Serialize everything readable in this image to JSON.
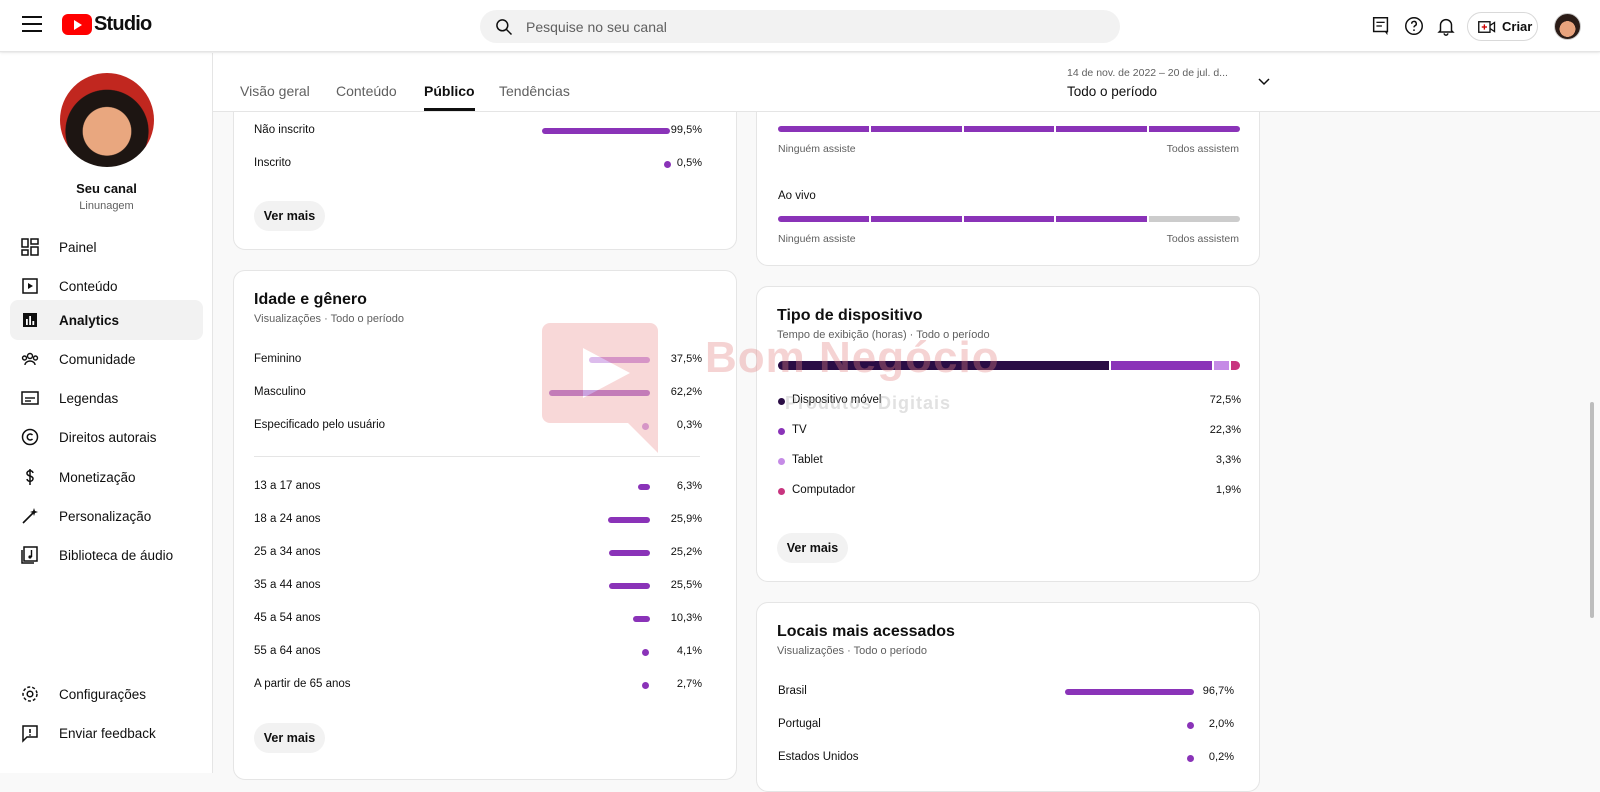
{
  "app": {
    "logo_text": "Studio",
    "search_placeholder": "Pesquise no seu canal",
    "create_label": "Criar"
  },
  "channel": {
    "name": "Seu canal",
    "handle": "Linunagem"
  },
  "sidebar": {
    "items": [
      {
        "label": "Painel",
        "icon": "dashboard-icon"
      },
      {
        "label": "Conteúdo",
        "icon": "content-icon"
      },
      {
        "label": "Analytics",
        "icon": "analytics-icon",
        "active": true
      },
      {
        "label": "Comunidade",
        "icon": "community-icon"
      },
      {
        "label": "Legendas",
        "icon": "subtitles-icon"
      },
      {
        "label": "Direitos autorais",
        "icon": "copyright-icon"
      },
      {
        "label": "Monetização",
        "icon": "monetization-icon"
      },
      {
        "label": "Personalização",
        "icon": "customization-icon"
      },
      {
        "label": "Biblioteca de áudio",
        "icon": "audio-library-icon"
      }
    ],
    "bottom": [
      {
        "label": "Configurações",
        "icon": "settings-icon"
      },
      {
        "label": "Enviar feedback",
        "icon": "feedback-icon"
      }
    ]
  },
  "tabs": [
    "Visão geral",
    "Conteúdo",
    "Público",
    "Tendências"
  ],
  "active_tab": "Público",
  "date_range": {
    "range": "14 de nov. de 2022 – 20 de jul. d...",
    "label": "Todo o período"
  },
  "subscription": {
    "rows": [
      {
        "label": "Não inscrito",
        "value": "99,5%",
        "pct": 99.5
      },
      {
        "label": "Inscrito",
        "value": "0,5%",
        "pct": 0.5
      }
    ],
    "more": "Ver mais"
  },
  "watch_frequency": {
    "min_label": "Ninguém assiste",
    "max_label": "Todos assistem",
    "live_title": "Ao vivo"
  },
  "age_gender": {
    "title": "Idade e gênero",
    "subtitle": "Visualizações · Todo o período",
    "gender": [
      {
        "label": "Feminino",
        "value": "37,5%",
        "pct": 37.5
      },
      {
        "label": "Masculino",
        "value": "62,2%",
        "pct": 62.2
      },
      {
        "label": "Especificado pelo usuário",
        "value": "0,3%",
        "pct": 0.3
      }
    ],
    "age": [
      {
        "label": "13 a 17 anos",
        "value": "6,3%",
        "pct": 6.3
      },
      {
        "label": "18 a 24 anos",
        "value": "25,9%",
        "pct": 25.9
      },
      {
        "label": "25 a 34 anos",
        "value": "25,2%",
        "pct": 25.2
      },
      {
        "label": "35 a 44 anos",
        "value": "25,5%",
        "pct": 25.5
      },
      {
        "label": "45 a 54 anos",
        "value": "10,3%",
        "pct": 10.3
      },
      {
        "label": "55 a 64 anos",
        "value": "4,1%",
        "pct": 4.1
      },
      {
        "label": "A partir de 65 anos",
        "value": "2,7%",
        "pct": 2.7
      }
    ],
    "more": "Ver mais"
  },
  "device": {
    "title": "Tipo de dispositivo",
    "subtitle": "Tempo de exibição (horas) · Todo o período",
    "rows": [
      {
        "label": "Dispositivo móvel",
        "value": "72,5%",
        "pct": 72.5,
        "color": "#2a0d45"
      },
      {
        "label": "TV",
        "value": "22,3%",
        "pct": 22.3,
        "color": "#8a33b8"
      },
      {
        "label": "Tablet",
        "value": "3,3%",
        "pct": 3.3,
        "color": "#c58be6"
      },
      {
        "label": "Computador",
        "value": "1,9%",
        "pct": 1.9,
        "color": "#c8357f"
      }
    ],
    "more": "Ver mais"
  },
  "locations": {
    "title": "Locais mais acessados",
    "subtitle": "Visualizações · Todo o período",
    "rows": [
      {
        "label": "Brasil",
        "value": "96,7%",
        "pct": 96.7
      },
      {
        "label": "Portugal",
        "value": "2,0%",
        "pct": 2.0
      },
      {
        "label": "Estados Unidos",
        "value": "0,2%",
        "pct": 0.2
      }
    ]
  },
  "watermark": {
    "brand": "Bom Negócio",
    "tagline": "Produtos Digitais"
  },
  "colors": {
    "accent": "#8a33b8",
    "light_accent": "#b36ad6",
    "track": "#cccccc"
  }
}
